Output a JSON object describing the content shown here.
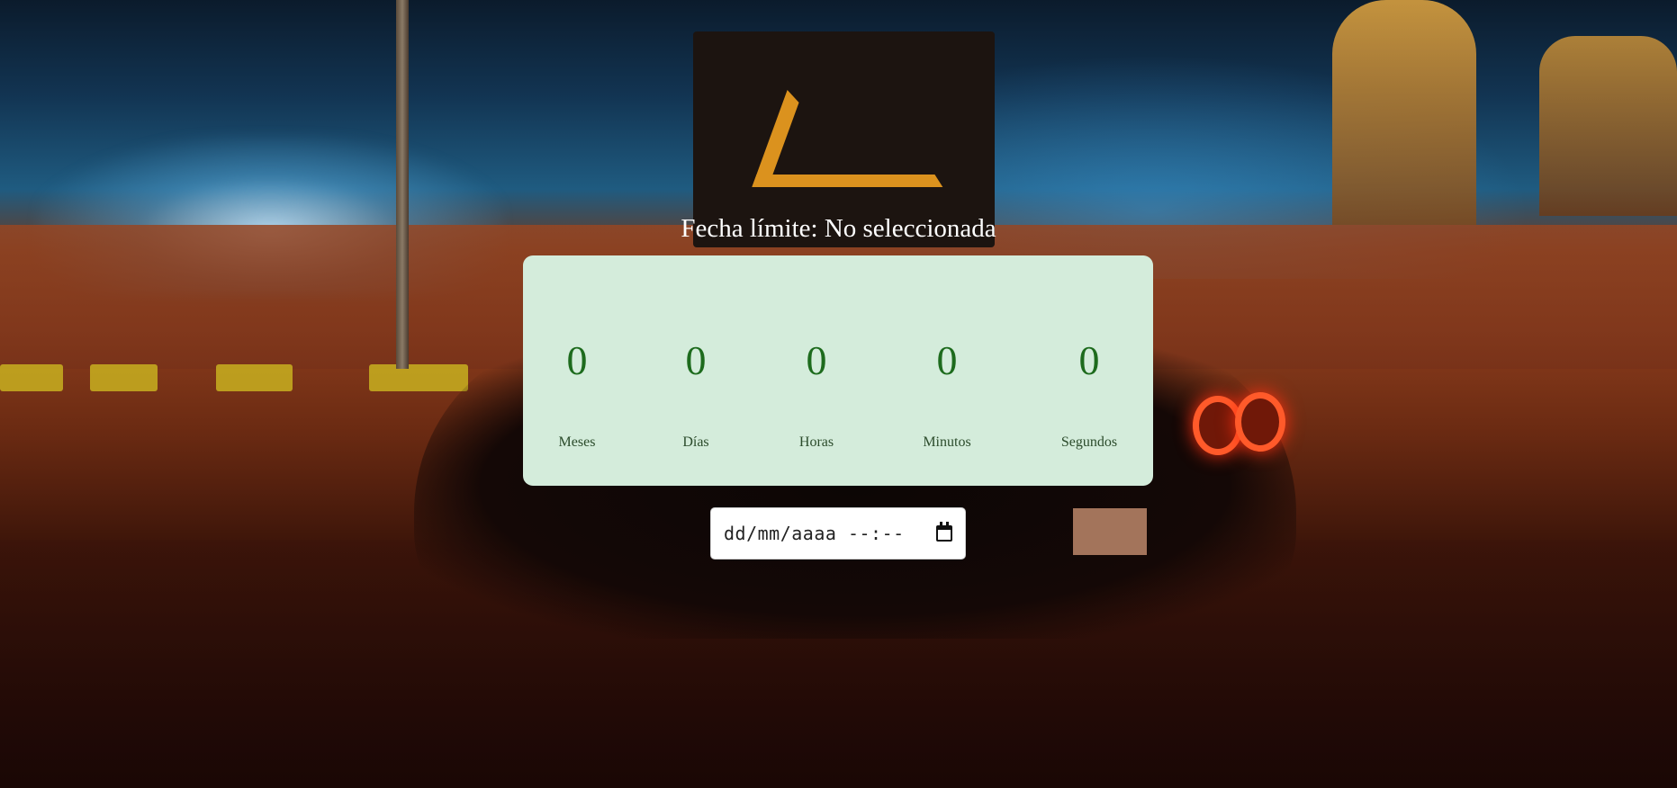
{
  "header": {
    "deadline_label": "Fecha límite: No seleccionada"
  },
  "countdown": {
    "units": [
      {
        "value": "0",
        "label": "Meses"
      },
      {
        "value": "0",
        "label": "Días"
      },
      {
        "value": "0",
        "label": "Horas"
      },
      {
        "value": "0",
        "label": "Minutos"
      },
      {
        "value": "0",
        "label": "Segundos"
      }
    ]
  },
  "date_input": {
    "placeholder": "dd/mm/aaaa --:--",
    "icon": "calendar-icon"
  },
  "colors": {
    "panel_bg": "#d4ecdb",
    "number": "#1d6b1d",
    "title": "#ffffff"
  }
}
